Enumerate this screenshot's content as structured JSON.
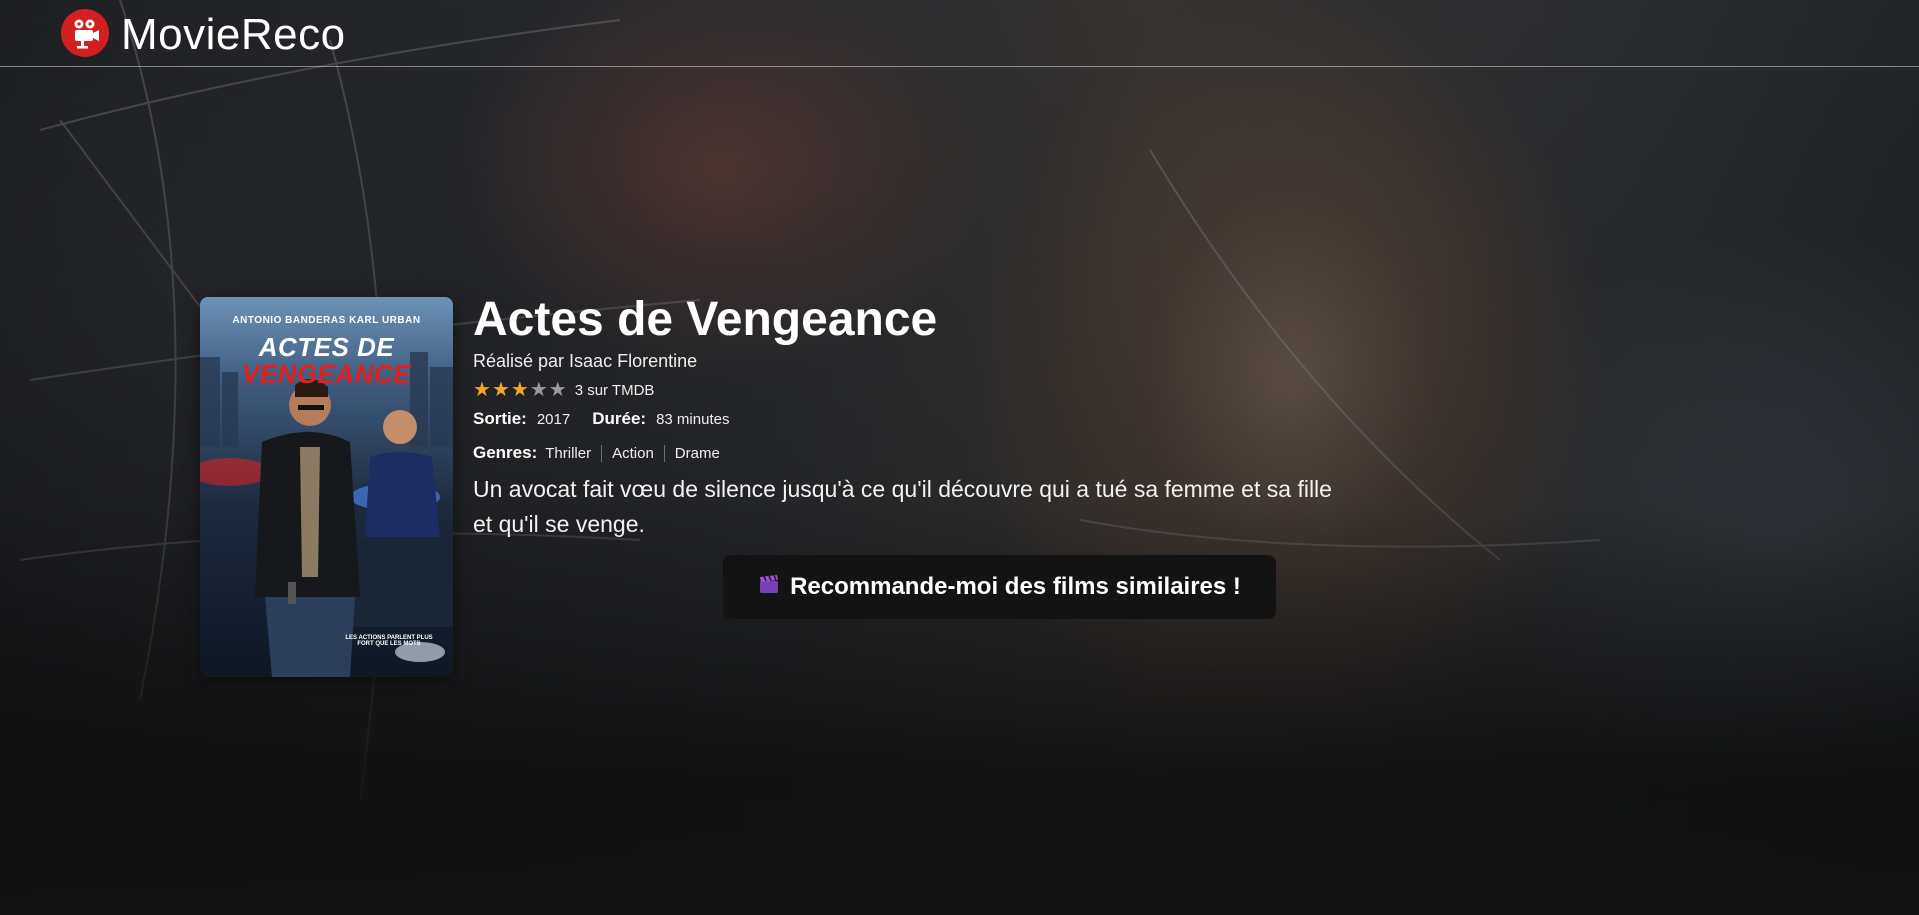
{
  "app": {
    "name": "MovieReco",
    "logo_icon": "film-camera-icon",
    "brand_color": "#d21f1f"
  },
  "poster": {
    "actors": "ANTONIO BANDERAS   KARL URBAN",
    "title_line1": "ACTES DE",
    "title_line2": "VENGEANCE",
    "tagline": "LES ACTIONS PARLENT PLUS FORT QUE LES MOTS"
  },
  "movie": {
    "title": "Actes de Vengeance",
    "director": "Réalisé par Isaac Florentine",
    "rating": 3,
    "rating_max": 5,
    "rating_text": "3 sur TMDB",
    "star_color_on": "#f5a623",
    "star_color_off": "#9a9a9a",
    "release_label": "Sortie:",
    "release_value": "2017",
    "duration_label": "Durée:",
    "duration_value": "83 minutes",
    "genres_label": "Genres:",
    "genres": [
      "Thriller",
      "Action",
      "Drame"
    ],
    "synopsis": "Un avocat fait vœu de silence jusqu'à ce qu'il découvre qui a tué sa femme et sa fille et qu'il se venge."
  },
  "cta": {
    "icon": "clapperboard-icon",
    "label": "Recommande-moi des films similaires !"
  }
}
